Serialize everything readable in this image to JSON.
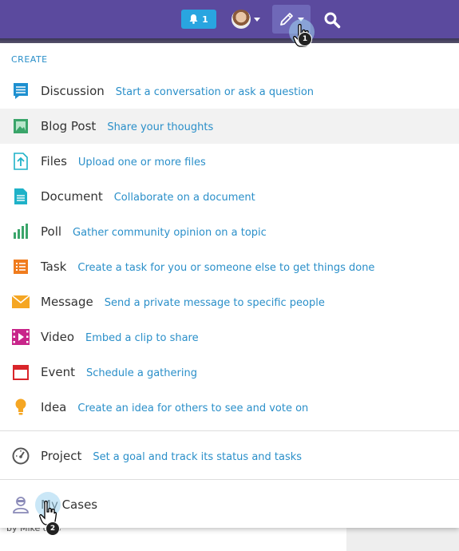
{
  "topbar": {
    "notification_count": "1",
    "colors": {
      "bar": "#5b4a9e",
      "notif": "#29a5e0",
      "compose": "#6f68b8"
    }
  },
  "menu": {
    "header": "CREATE",
    "items": [
      {
        "label": "Discussion",
        "desc": "Start a conversation or ask a question",
        "icon": "discussion-icon"
      },
      {
        "label": "Blog Post",
        "desc": "Share your thoughts",
        "icon": "blog-post-icon"
      },
      {
        "label": "Files",
        "desc": "Upload one or more files",
        "icon": "files-icon"
      },
      {
        "label": "Document",
        "desc": "Collaborate on a document",
        "icon": "document-icon"
      },
      {
        "label": "Poll",
        "desc": "Gather community opinion on a topic",
        "icon": "poll-icon"
      },
      {
        "label": "Task",
        "desc": "Create a task for you or someone else to get things done",
        "icon": "task-icon"
      },
      {
        "label": "Message",
        "desc": "Send a private message to specific people",
        "icon": "message-icon"
      },
      {
        "label": "Video",
        "desc": "Embed a clip to share",
        "icon": "video-icon"
      },
      {
        "label": "Event",
        "desc": "Schedule a gathering",
        "icon": "event-icon"
      },
      {
        "label": "Idea",
        "desc": "Create an idea for others to see and vote on",
        "icon": "idea-icon"
      }
    ],
    "project": {
      "label": "Project",
      "desc": "Set a goal and track its status and tasks",
      "icon": "project-icon"
    },
    "cases": {
      "label": "My Cases",
      "icon": "cases-icon"
    }
  },
  "steps": {
    "one": "1",
    "two": "2"
  },
  "background": {
    "byline": "by Mike      olds"
  }
}
